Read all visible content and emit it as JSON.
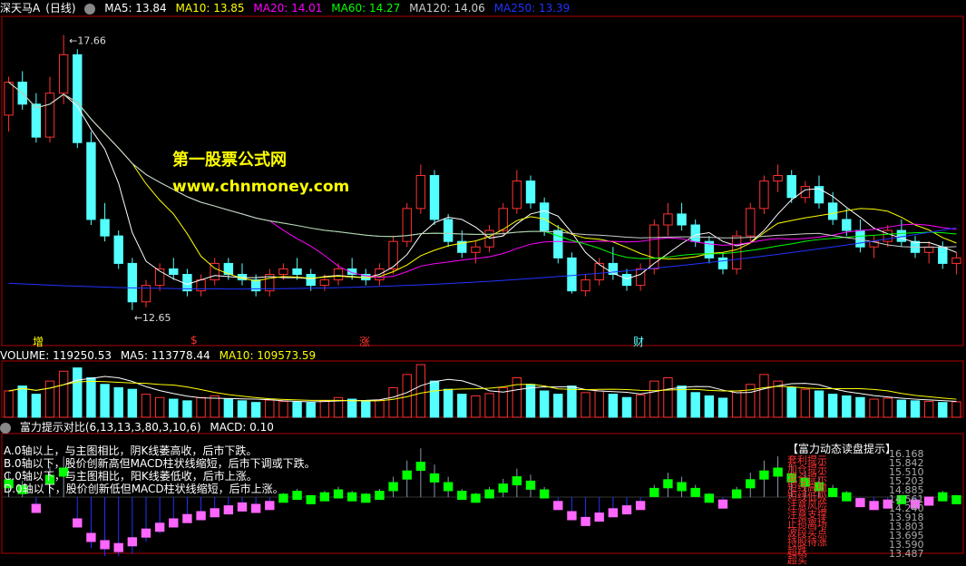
{
  "header": {
    "stock_name": "深天马A",
    "period": "(日线)",
    "ma5": "MA5: 13.84",
    "ma10": "MA10: 13.85",
    "ma20": "MA20: 14.01",
    "ma60": "MA60: 14.27",
    "ma120": "MA120: 14.06",
    "ma250": "MA250: 13.39"
  },
  "colors": {
    "up": "#ff3232",
    "down": "#54ffff",
    "ma5": "#ffffff",
    "ma10": "#ffff00",
    "ma20": "#ff00ff",
    "ma60": "#00ff00",
    "ma120": "#cccccc",
    "ma250": "#2233ff",
    "grid": "#b00000"
  },
  "watermark": {
    "line1": "第一股票公式网",
    "line2": "www.chnmoney.com"
  },
  "price_panel": {
    "high_label": "17.66",
    "low_label": "12.65",
    "markers": [
      "增",
      "$",
      "涨",
      "财"
    ]
  },
  "volume_panel": {
    "title": "VOLUME: 119250.53",
    "ma5": "MA5: 113778.44",
    "ma10": "MA10: 109573.59"
  },
  "indicator_panel": {
    "title": "富力提示对比(6,13,13,3,80,3,10,6)",
    "macd": "MACD: 0.10",
    "notes": [
      "A.0轴以上，与主图相比，阴K线萎高收，后市下跌。",
      "B.0轴以下，股价创新高但MACD柱状线缩短，后市下调或下跌。",
      "C.0轴以下，与主图相比，阳K线萎低收，后市上涨。",
      "D.0轴以下，股价创新低但MACD柱状线缩短，后市上涨。"
    ],
    "right_title": "【富力动态读盘提示】",
    "right_labels": [
      "套利提示",
      "加仓提示",
      "减仓提示",
      "短线高抛",
      "短线低吸",
      "注意风险",
      "注意支撑",
      "止损离场",
      "波段买点",
      "持股待涨",
      "超跌",
      "超买"
    ],
    "right_values": [
      "16.168",
      "15.842",
      "15.510",
      "15.203",
      "14.885",
      "14.561",
      "14.240",
      "13.918",
      "13.803",
      "13.695",
      "13.590",
      "13.487"
    ]
  },
  "chart_data": [
    {
      "type": "candlestick",
      "title": "深天马A (日线)",
      "ylim": [
        12.4,
        17.9
      ],
      "high": 17.66,
      "low": 12.65,
      "ohlc": [
        [
          16.2,
          16.9,
          15.9,
          16.8
        ],
        [
          16.8,
          17.0,
          16.3,
          16.4
        ],
        [
          16.4,
          16.6,
          15.7,
          15.8
        ],
        [
          15.8,
          16.9,
          15.7,
          16.6
        ],
        [
          16.6,
          17.66,
          16.4,
          17.3
        ],
        [
          17.3,
          17.4,
          15.6,
          15.7
        ],
        [
          15.7,
          15.9,
          14.2,
          14.3
        ],
        [
          14.3,
          14.6,
          13.9,
          14.0
        ],
        [
          14.0,
          14.1,
          13.4,
          13.5
        ],
        [
          13.5,
          13.6,
          12.65,
          12.8
        ],
        [
          12.8,
          13.2,
          12.7,
          13.1
        ],
        [
          13.1,
          13.5,
          13.0,
          13.4
        ],
        [
          13.4,
          13.6,
          13.2,
          13.3
        ],
        [
          13.3,
          13.4,
          12.9,
          13.0
        ],
        [
          13.0,
          13.3,
          12.9,
          13.2
        ],
        [
          13.2,
          13.6,
          13.1,
          13.5
        ],
        [
          13.5,
          13.6,
          13.2,
          13.3
        ],
        [
          13.3,
          13.5,
          13.1,
          13.2
        ],
        [
          13.2,
          13.3,
          12.9,
          13.0
        ],
        [
          13.0,
          13.4,
          12.9,
          13.3
        ],
        [
          13.3,
          13.5,
          13.2,
          13.4
        ],
        [
          13.4,
          13.6,
          13.2,
          13.3
        ],
        [
          13.3,
          13.4,
          13.0,
          13.1
        ],
        [
          13.1,
          13.3,
          13.0,
          13.2
        ],
        [
          13.2,
          13.5,
          13.1,
          13.4
        ],
        [
          13.4,
          13.6,
          13.2,
          13.3
        ],
        [
          13.3,
          13.4,
          13.1,
          13.2
        ],
        [
          13.2,
          13.5,
          13.1,
          13.4
        ],
        [
          13.4,
          14.0,
          13.3,
          13.9
        ],
        [
          13.9,
          14.6,
          13.8,
          14.5
        ],
        [
          14.5,
          15.3,
          14.4,
          15.1
        ],
        [
          15.1,
          15.2,
          14.2,
          14.3
        ],
        [
          14.3,
          14.4,
          13.8,
          13.9
        ],
        [
          13.9,
          14.1,
          13.6,
          13.7
        ],
        [
          13.7,
          13.9,
          13.5,
          13.8
        ],
        [
          13.8,
          14.2,
          13.7,
          14.1
        ],
        [
          14.1,
          14.6,
          14.0,
          14.5
        ],
        [
          14.5,
          15.2,
          14.4,
          15.0
        ],
        [
          15.0,
          15.1,
          14.5,
          14.6
        ],
        [
          14.6,
          14.7,
          14.0,
          14.1
        ],
        [
          14.1,
          14.2,
          13.5,
          13.6
        ],
        [
          13.6,
          13.7,
          12.95,
          13.0
        ],
        [
          13.0,
          13.3,
          12.9,
          13.2
        ],
        [
          13.2,
          13.6,
          13.1,
          13.5
        ],
        [
          13.5,
          13.8,
          13.2,
          13.3
        ],
        [
          13.3,
          13.4,
          13.0,
          13.1
        ],
        [
          13.1,
          13.5,
          13.0,
          13.4
        ],
        [
          13.4,
          14.3,
          13.3,
          14.2
        ],
        [
          14.2,
          14.6,
          14.0,
          14.4
        ],
        [
          14.4,
          14.6,
          14.1,
          14.2
        ],
        [
          14.2,
          14.3,
          13.8,
          13.9
        ],
        [
          13.9,
          14.0,
          13.5,
          13.6
        ],
        [
          13.6,
          13.7,
          13.3,
          13.4
        ],
        [
          13.4,
          14.1,
          13.3,
          14.0
        ],
        [
          14.0,
          14.6,
          13.9,
          14.5
        ],
        [
          14.5,
          15.1,
          14.4,
          15.0
        ],
        [
          15.0,
          15.3,
          14.8,
          15.1
        ],
        [
          15.1,
          15.2,
          14.6,
          14.7
        ],
        [
          14.7,
          15.0,
          14.6,
          14.9
        ],
        [
          14.9,
          15.1,
          14.5,
          14.6
        ],
        [
          14.6,
          14.8,
          14.2,
          14.3
        ],
        [
          14.3,
          14.5,
          14.0,
          14.1
        ],
        [
          14.1,
          14.3,
          13.7,
          13.8
        ],
        [
          13.8,
          14.0,
          13.6,
          13.9
        ],
        [
          13.9,
          14.2,
          13.8,
          14.1
        ],
        [
          14.1,
          14.3,
          13.8,
          13.9
        ],
        [
          13.9,
          14.0,
          13.6,
          13.7
        ],
        [
          13.7,
          13.9,
          13.5,
          13.8
        ],
        [
          13.8,
          13.9,
          13.4,
          13.5
        ],
        [
          13.5,
          13.7,
          13.3,
          13.6
        ]
      ]
    },
    {
      "type": "bar",
      "title": "VOLUME",
      "values": [
        80,
        95,
        70,
        110,
        140,
        150,
        120,
        100,
        90,
        85,
        70,
        60,
        55,
        50,
        60,
        65,
        55,
        50,
        45,
        52,
        48,
        46,
        44,
        50,
        60,
        55,
        48,
        52,
        90,
        130,
        160,
        110,
        85,
        70,
        65,
        72,
        90,
        120,
        100,
        80,
        70,
        95,
        75,
        80,
        70,
        60,
        68,
        110,
        120,
        95,
        75,
        65,
        58,
        80,
        100,
        130,
        110,
        90,
        85,
        80,
        70,
        65,
        60,
        55,
        58,
        52,
        50,
        48,
        45,
        47
      ]
    },
    {
      "type": "bar",
      "title": "富力提示对比",
      "values": [
        1.2,
        0.8,
        -0.5,
        1.5,
        2.0,
        -1.5,
        -2.5,
        -3.0,
        -3.2,
        -2.8,
        -2.2,
        -1.8,
        -1.5,
        -1.2,
        -1.0,
        -0.8,
        -0.6,
        -0.4,
        -0.5,
        -0.3,
        0.2,
        0.4,
        0.1,
        0.3,
        0.5,
        0.3,
        0.2,
        0.4,
        1.0,
        1.8,
        2.4,
        1.6,
        1.0,
        0.4,
        0.2,
        0.5,
        0.9,
        1.4,
        1.1,
        0.5,
        -0.3,
        -1.0,
        -1.4,
        -1.1,
        -0.8,
        -0.6,
        -0.3,
        0.6,
        1.2,
        1.0,
        0.6,
        0.2,
        -0.2,
        0.5,
        1.2,
        1.8,
        2.0,
        1.6,
        1.3,
        1.0,
        0.6,
        0.3,
        -0.1,
        -0.3,
        -0.2,
        0.1,
        -0.2,
        0.0,
        0.3,
        0.1
      ]
    }
  ]
}
